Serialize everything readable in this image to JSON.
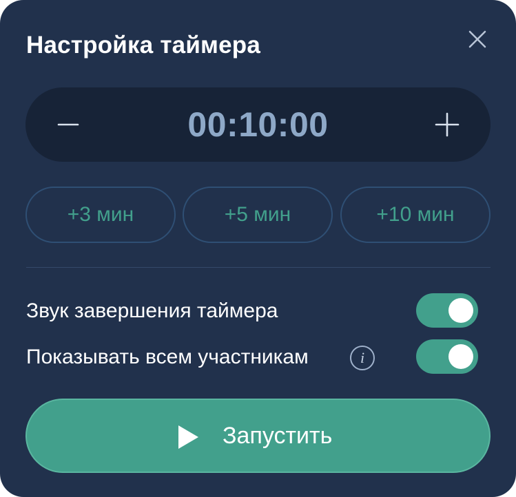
{
  "dialog": {
    "title": "Настройка таймера",
    "close_icon": "close-icon"
  },
  "timer": {
    "value": "00:10:00",
    "decrement_icon": "minus-icon",
    "increment_icon": "plus-icon"
  },
  "quick_add": [
    {
      "label": "+3 мин"
    },
    {
      "label": "+5 мин"
    },
    {
      "label": "+10 мин"
    }
  ],
  "settings": {
    "sound": {
      "label": "Звук завершения таймера",
      "enabled": true
    },
    "show_all": {
      "label": "Показывать всем участникам",
      "enabled": true,
      "info_glyph": "i"
    }
  },
  "start": {
    "label": "Запустить",
    "icon": "play-icon"
  },
  "colors": {
    "background": "#21314c",
    "time_bar": "#172337",
    "accent": "#42a08c",
    "time_text": "#8ea8c7",
    "outline": "#2f4f74"
  }
}
